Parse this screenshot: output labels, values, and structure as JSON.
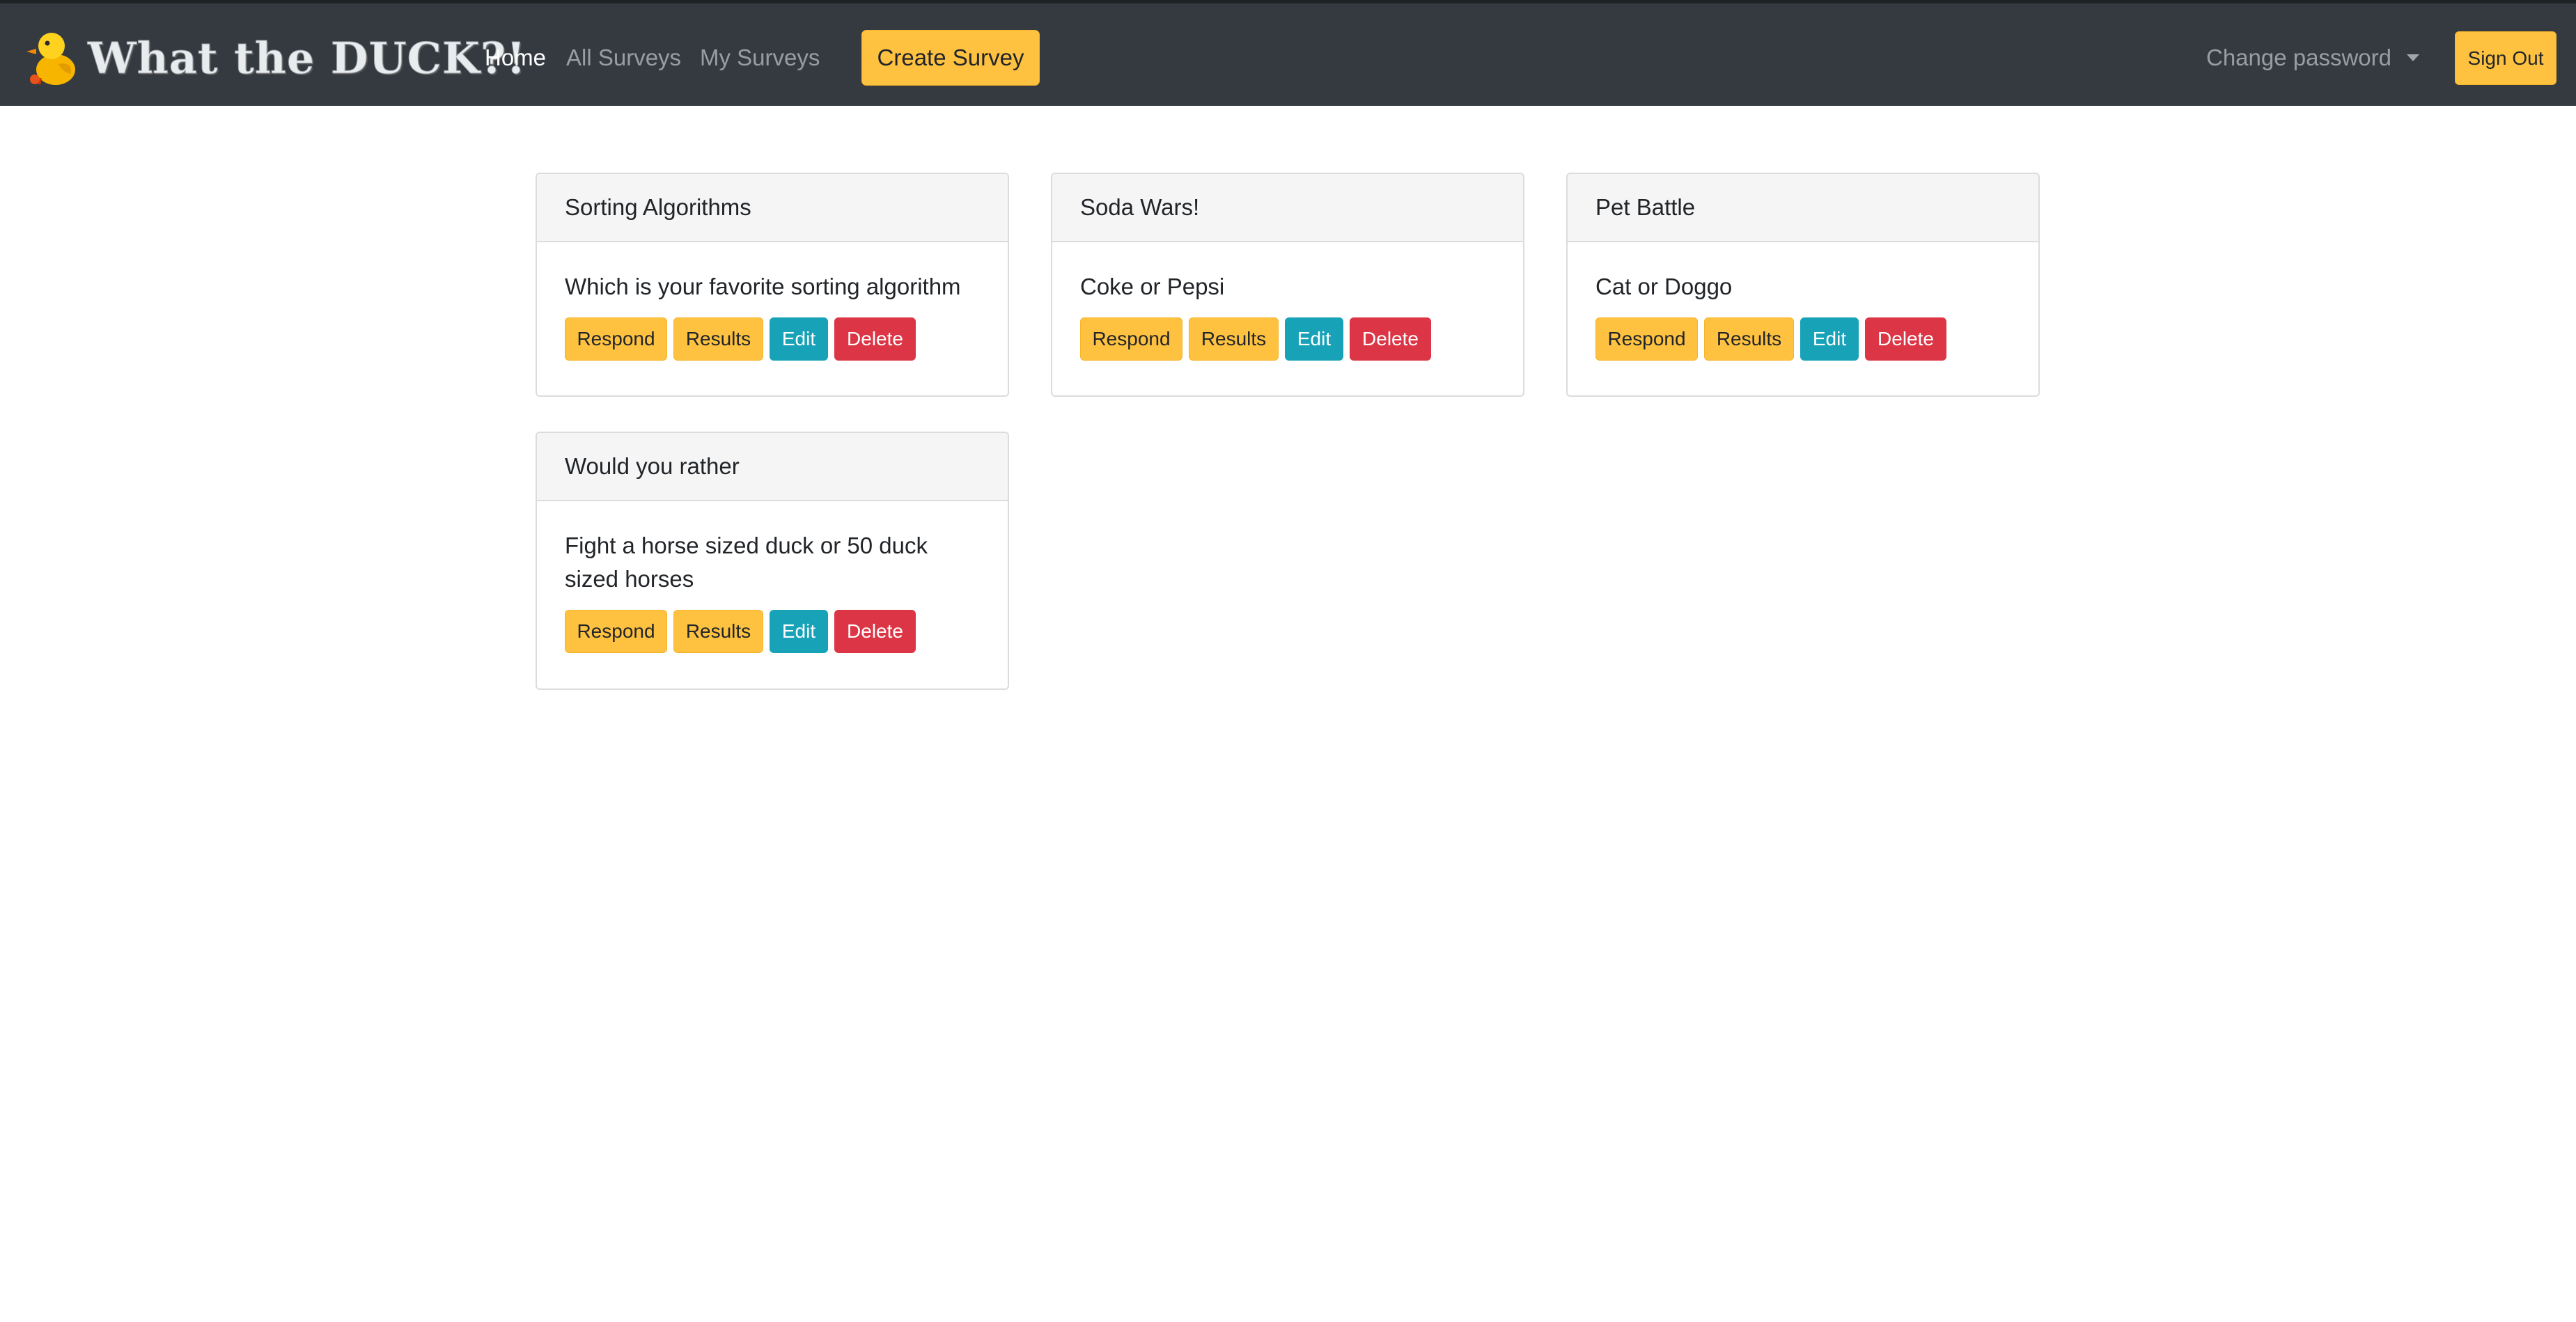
{
  "navbar": {
    "brand": "What the DUCK?!",
    "links": [
      "Home",
      "All Surveys",
      "My Surveys"
    ],
    "create_label": "Create Survey",
    "change_password_label": "Change password",
    "sign_out_label": "Sign Out"
  },
  "surveys": [
    {
      "title": "Sorting Algorithms",
      "question": "Which is your favorite sorting algorithm"
    },
    {
      "title": "Soda Wars!",
      "question": "Coke or Pepsi"
    },
    {
      "title": "Pet Battle",
      "question": "Cat or Doggo"
    },
    {
      "title": "Would you rather",
      "question": "Fight a horse sized duck or 50 duck sized horses"
    }
  ],
  "card_actions": {
    "respond": "Respond",
    "results": "Results",
    "edit": "Edit",
    "delete": "Delete"
  },
  "colors": {
    "navbar_bg": "#343a40",
    "warning": "#ffc240",
    "info": "#17a2b8",
    "danger": "#dc3545"
  },
  "icons": {
    "brand_logo": "duck-icon",
    "dropdown": "caret-down-icon"
  }
}
